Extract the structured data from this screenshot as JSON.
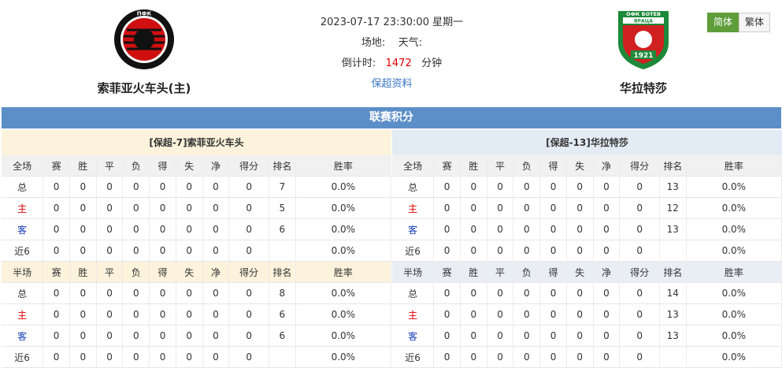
{
  "header": {
    "home_team": "索菲亚火车头(主)",
    "away_team": "华拉特莎",
    "datetime": "2023-07-17 23:30:00 星期一",
    "venue_label": "场地:",
    "weather_label": "天气:",
    "countdown_label": "倒计时:",
    "countdown_value": "1472",
    "countdown_unit": "分钟",
    "league_link": "保超资料",
    "home_logo_text_top": "ПФК",
    "home_logo_text_bottom": "ЛОКОМОТИВ • СОФИЯ",
    "away_logo_text_top": "ОФК БОТЕВ",
    "away_logo_text_mid": "ВРАЦА",
    "away_logo_year": "1921"
  },
  "lang": {
    "simplified": "简体",
    "traditional": "繁体"
  },
  "standings_title": "联赛积分",
  "columns": [
    "赛",
    "胜",
    "平",
    "负",
    "得",
    "失",
    "净",
    "得分",
    "排名",
    "胜率"
  ],
  "home_panel": {
    "title": "[保超-7]索菲亚火车头",
    "full_label": "全场",
    "half_label": "半场",
    "full": [
      {
        "label": "总",
        "cells": [
          "0",
          "0",
          "0",
          "0",
          "0",
          "0",
          "0",
          "0",
          "7",
          "0.0%"
        ]
      },
      {
        "label": "主",
        "cells": [
          "0",
          "0",
          "0",
          "0",
          "0",
          "0",
          "0",
          "0",
          "5",
          "0.0%"
        ]
      },
      {
        "label": "客",
        "cells": [
          "0",
          "0",
          "0",
          "0",
          "0",
          "0",
          "0",
          "0",
          "6",
          "0.0%"
        ]
      },
      {
        "label": "近6",
        "cells": [
          "0",
          "0",
          "0",
          "0",
          "0",
          "0",
          "0",
          "0",
          "",
          "0.0%"
        ]
      }
    ],
    "half": [
      {
        "label": "总",
        "cells": [
          "0",
          "0",
          "0",
          "0",
          "0",
          "0",
          "0",
          "0",
          "8",
          "0.0%"
        ]
      },
      {
        "label": "主",
        "cells": [
          "0",
          "0",
          "0",
          "0",
          "0",
          "0",
          "0",
          "0",
          "6",
          "0.0%"
        ]
      },
      {
        "label": "客",
        "cells": [
          "0",
          "0",
          "0",
          "0",
          "0",
          "0",
          "0",
          "0",
          "6",
          "0.0%"
        ]
      },
      {
        "label": "近6",
        "cells": [
          "0",
          "0",
          "0",
          "0",
          "0",
          "0",
          "0",
          "0",
          "",
          "0.0%"
        ]
      }
    ]
  },
  "away_panel": {
    "title": "[保超-13]华拉特莎",
    "full_label": "全场",
    "half_label": "半场",
    "full": [
      {
        "label": "总",
        "cells": [
          "0",
          "0",
          "0",
          "0",
          "0",
          "0",
          "0",
          "0",
          "13",
          "0.0%"
        ]
      },
      {
        "label": "主",
        "cells": [
          "0",
          "0",
          "0",
          "0",
          "0",
          "0",
          "0",
          "0",
          "12",
          "0.0%"
        ]
      },
      {
        "label": "客",
        "cells": [
          "0",
          "0",
          "0",
          "0",
          "0",
          "0",
          "0",
          "0",
          "13",
          "0.0%"
        ]
      },
      {
        "label": "近6",
        "cells": [
          "0",
          "0",
          "0",
          "0",
          "0",
          "0",
          "0",
          "0",
          "",
          "0.0%"
        ]
      }
    ],
    "half": [
      {
        "label": "总",
        "cells": [
          "0",
          "0",
          "0",
          "0",
          "0",
          "0",
          "0",
          "0",
          "14",
          "0.0%"
        ]
      },
      {
        "label": "主",
        "cells": [
          "0",
          "0",
          "0",
          "0",
          "0",
          "0",
          "0",
          "0",
          "13",
          "0.0%"
        ]
      },
      {
        "label": "客",
        "cells": [
          "0",
          "0",
          "0",
          "0",
          "0",
          "0",
          "0",
          "0",
          "13",
          "0.0%"
        ]
      },
      {
        "label": "近6",
        "cells": [
          "0",
          "0",
          "0",
          "0",
          "0",
          "0",
          "0",
          "0",
          "",
          "0.0%"
        ]
      }
    ]
  },
  "colors": {
    "accent_bar": "#5c8fc8",
    "active_lang": "#5f9d3a",
    "home_red": "#e00000",
    "away_blue": "#1a3fb5"
  }
}
